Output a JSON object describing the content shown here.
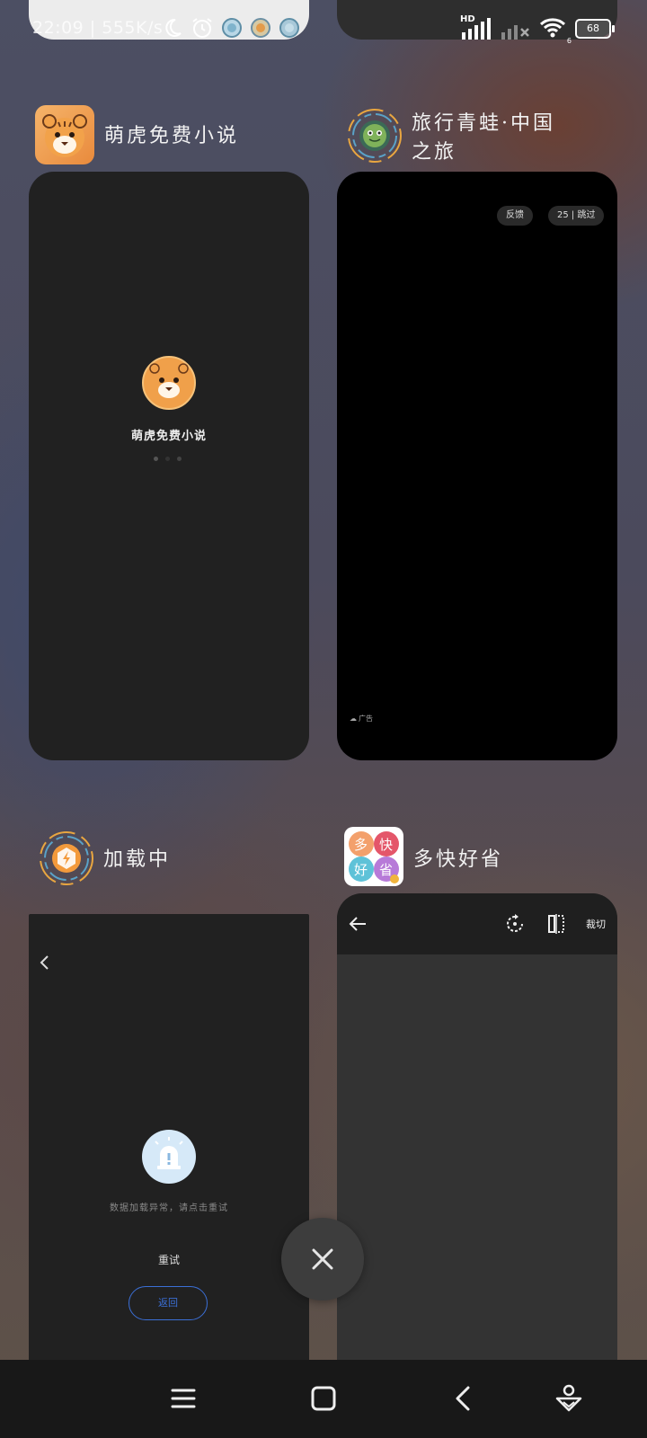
{
  "status_bar": {
    "time": "22:09",
    "speed": "555K/s",
    "hd": "HD",
    "wifi_sub": "6",
    "battery": "68"
  },
  "apps": [
    {
      "title": "萌虎免费小说",
      "icon": "tiger-icon",
      "splash_name": "萌虎免费小说"
    },
    {
      "title_line1": "旅行青蛙·中国",
      "title_line2": "之旅",
      "icon": "frog-icon",
      "feedback_label": "反馈",
      "skip_label": "25 | 跳过",
      "ad_label": "广告"
    },
    {
      "title": "加载中",
      "icon": "loading-app-icon",
      "error_message": "数据加载异常，请点击重试",
      "retry_label": "重试",
      "back_label": "返回"
    },
    {
      "title": "多快好省",
      "icon": "duokuai-icon",
      "icon_chars": [
        "多",
        "快",
        "好",
        "省"
      ],
      "crop_label": "裁切"
    }
  ],
  "colors": {
    "card_dark": "#212121",
    "card_black": "#000000",
    "accent_blue": "#3b6fd6"
  }
}
